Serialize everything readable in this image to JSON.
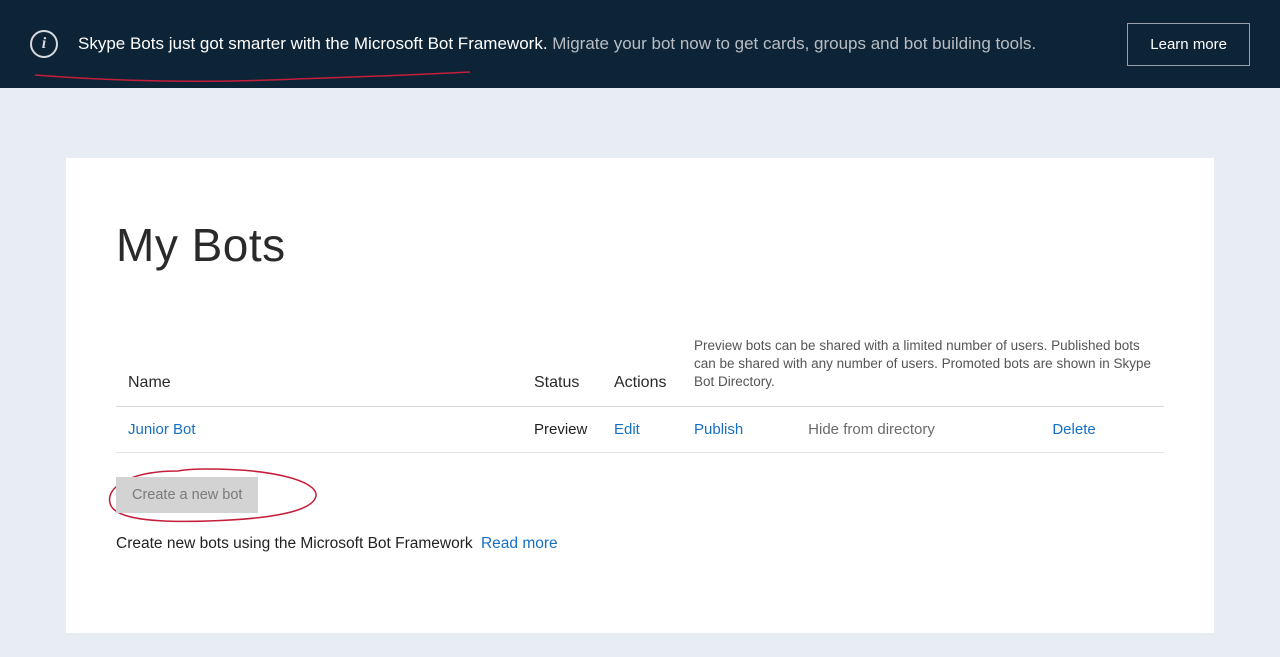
{
  "banner": {
    "bold_text": "Skype Bots just got smarter with the Microsoft Bot Framework.",
    "light_text": " Migrate your bot now to get cards, groups and bot building tools.",
    "button_label": "Learn more"
  },
  "page": {
    "title": "My Bots"
  },
  "table": {
    "headers": {
      "name": "Name",
      "status": "Status",
      "actions": "Actions",
      "helper": "Preview bots can be shared with a limited number of users. Published bots can be shared with any number of users. Promoted bots are shown in Skype Bot Directory."
    },
    "rows": [
      {
        "name": "Junior Bot",
        "status": "Preview",
        "edit": "Edit",
        "publish": "Publish",
        "hide": "Hide from directory",
        "delete": "Delete"
      }
    ]
  },
  "create_button": "Create a new bot",
  "footer": {
    "text": "Create new bots using the Microsoft Bot Framework",
    "link": "Read more"
  }
}
